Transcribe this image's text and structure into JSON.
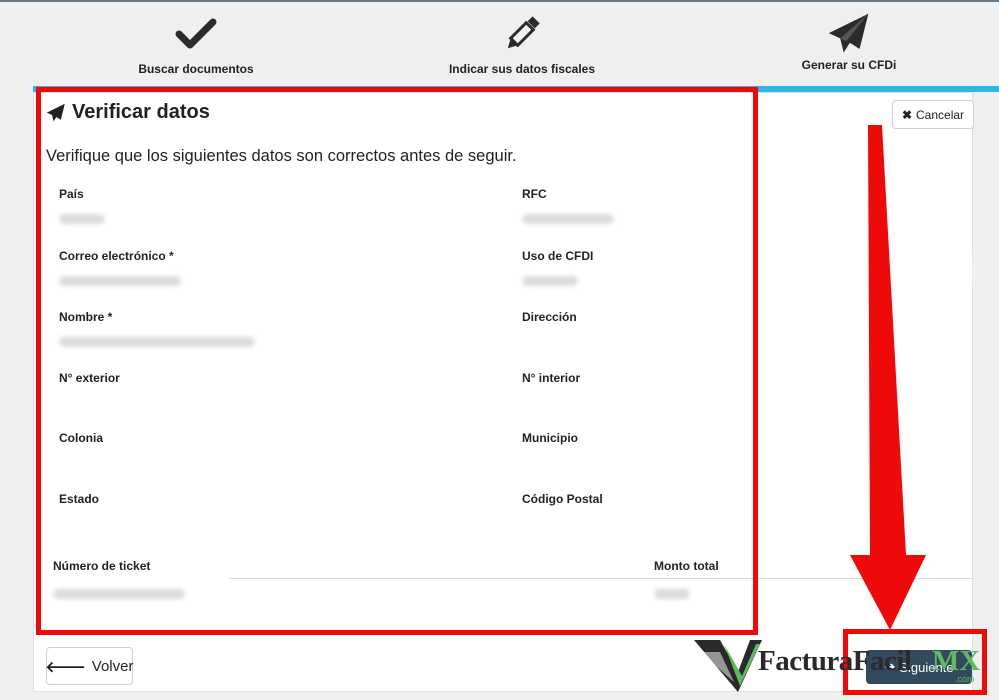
{
  "steps": [
    {
      "label": "Buscar documentos",
      "icon": "check-icon"
    },
    {
      "label": "Indicar sus datos fiscales",
      "icon": "pencil-icon"
    },
    {
      "label": "Generar su CFDi",
      "icon": "paper-plane-icon"
    }
  ],
  "progress": {
    "active_step": 3,
    "total_steps": 3
  },
  "page": {
    "title": "Verificar datos",
    "intro": "Verifique que los siguientes datos son correctos antes de seguir."
  },
  "cancel_label": "Cancelar",
  "fields": {
    "pais": "País",
    "rfc": "RFC",
    "correo": "Correo electrónico *",
    "uso_cfdi": "Uso de CFDI",
    "nombre": "Nombre *",
    "direccion": "Dirección",
    "exterior": "N° exterior",
    "interior": "N° interior",
    "colonia": "Colonia",
    "municipio": "Municipio",
    "estado": "Estado",
    "codigo_postal": "Código Postal"
  },
  "ticket": {
    "numero_label": "Número de ticket",
    "monto_label": "Monto total"
  },
  "nav": {
    "back_label": "Volver",
    "next_label": "Siguiente"
  },
  "watermark": {
    "brand": "FacturaFacil",
    "suffix": "MX",
    "domain": ".com"
  },
  "colors": {
    "accent": "#2db7e6",
    "annotation": "#ef0a0a",
    "primary_button": "#33495e"
  }
}
